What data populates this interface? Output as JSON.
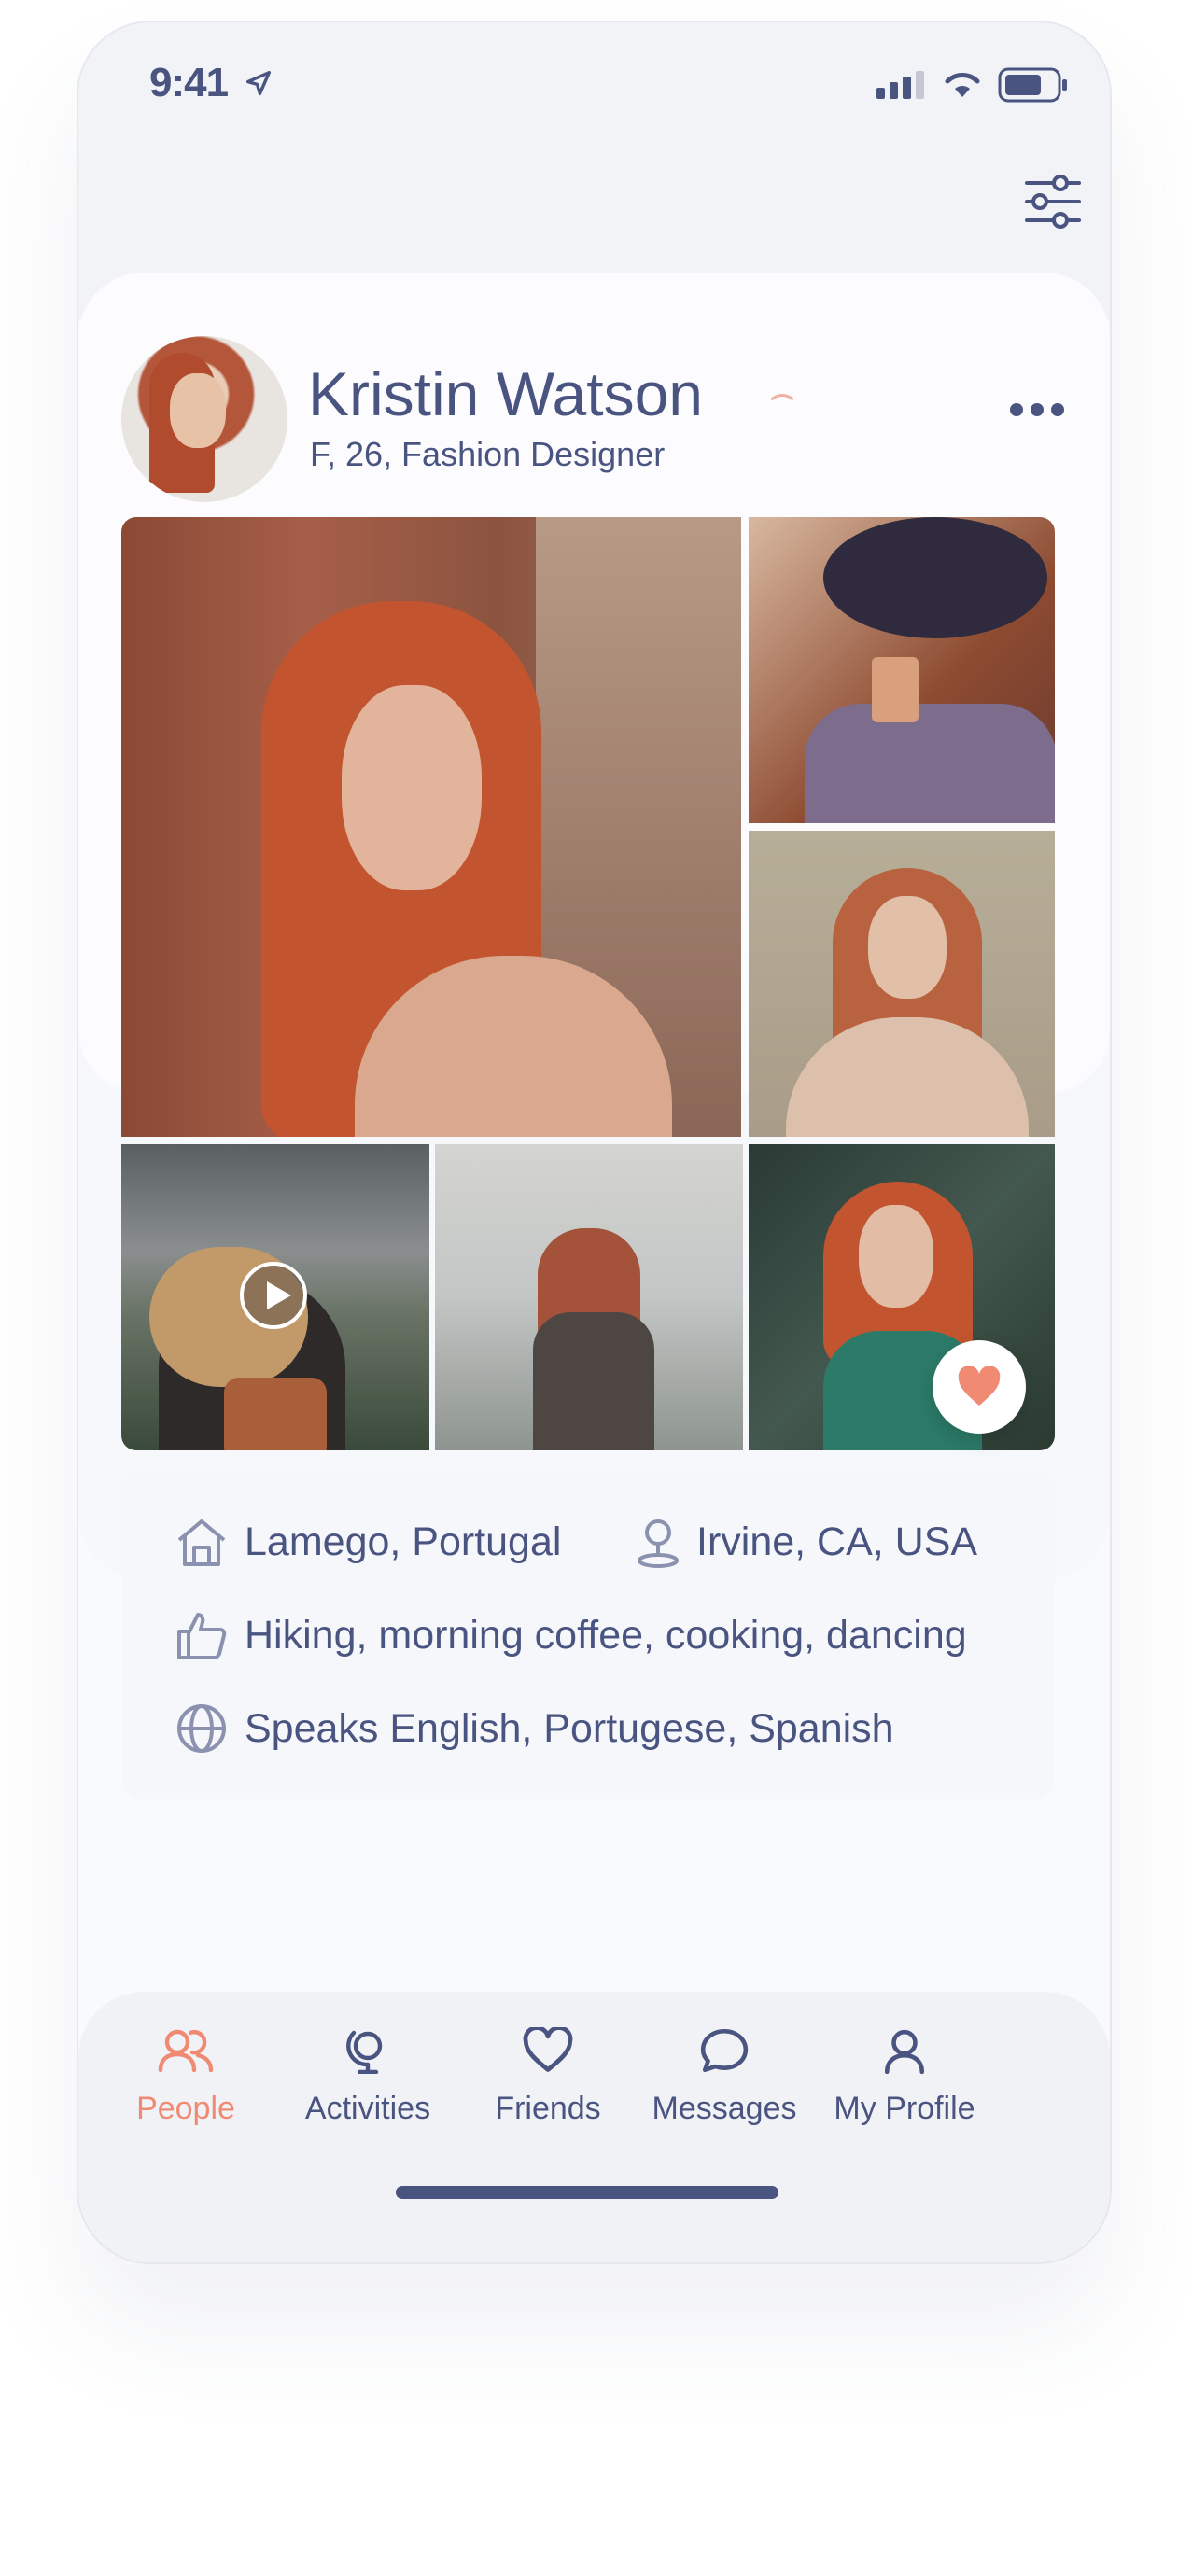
{
  "status_bar": {
    "time": "9:41"
  },
  "profile": {
    "name": "Kristin Watson",
    "subtitle": "F, 26, Fashion Designer"
  },
  "gallery": {
    "photo_count": 6,
    "has_video_in_slot": 4,
    "liked": true
  },
  "info": {
    "hometown": "Lamego, Portugal",
    "current_location": "Irvine, CA, USA",
    "interests": "Hiking, morning coffee, cooking, dancing",
    "languages": "Speaks English, Portugese, Spanish"
  },
  "tabbar": {
    "items": [
      {
        "label": "People",
        "icon": "people-icon",
        "active": true
      },
      {
        "label": "Activities",
        "icon": "activities-icon",
        "active": false
      },
      {
        "label": "Friends",
        "icon": "heart-icon",
        "active": false
      },
      {
        "label": "Messages",
        "icon": "chat-bubble-icon",
        "active": false
      },
      {
        "label": "My Profile",
        "icon": "user-icon",
        "active": false
      }
    ]
  },
  "colors": {
    "text": "#4a5480",
    "accent": "#f08a72",
    "background": "#f9fafd"
  }
}
